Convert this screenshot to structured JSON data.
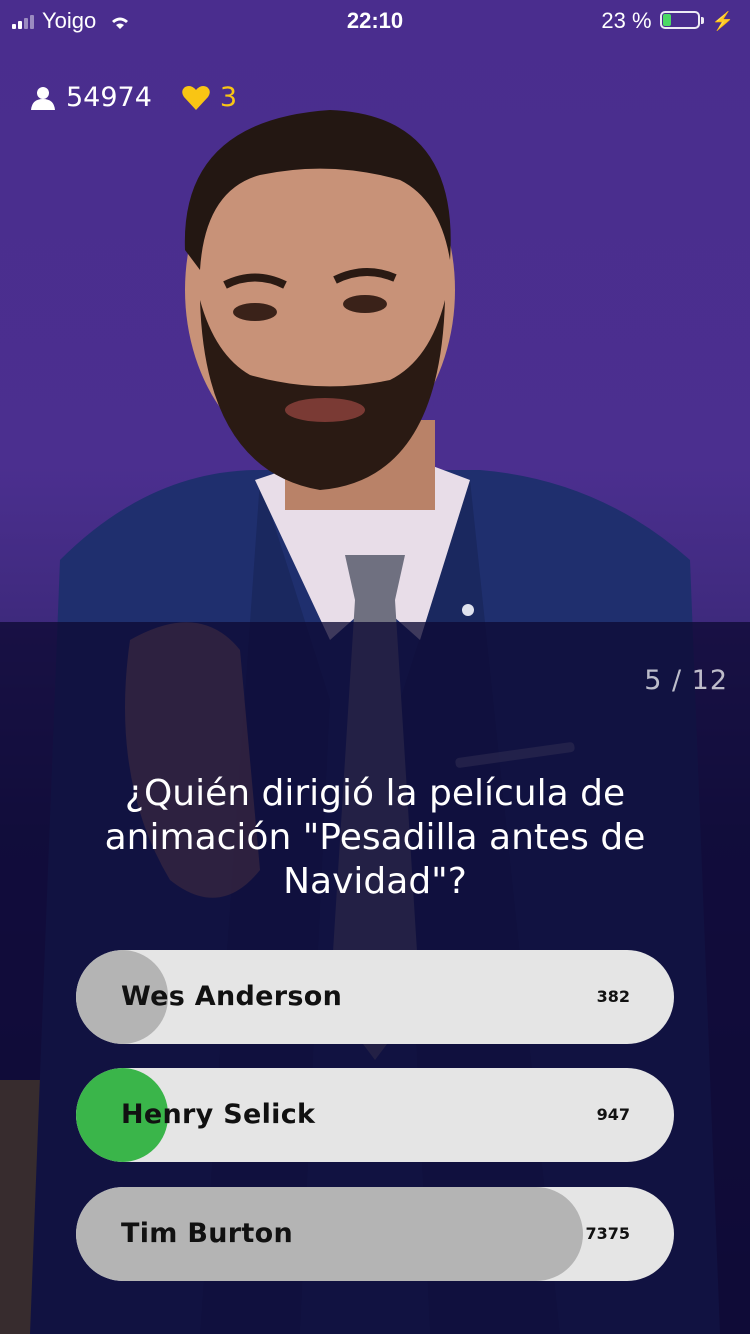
{
  "status_bar": {
    "carrier": "Yoigo",
    "time": "22:10",
    "battery_percent": "23 %",
    "battery_level": 0.23
  },
  "stats": {
    "viewers": "54974",
    "lives": "3",
    "lives_color": "#f9c514"
  },
  "quiz": {
    "counter": "5 / 12",
    "question": "¿Quién dirigió la película de animación \"Pesadilla antes de Navidad\"?",
    "answers": [
      {
        "label": "Wes Anderson",
        "count": "382",
        "share": 0.044,
        "state": "wrong",
        "fill_color": "#b4b4b4"
      },
      {
        "label": "Henry Selick",
        "count": "947",
        "share": 0.109,
        "state": "correct",
        "fill_color": "#3ab54a"
      },
      {
        "label": "Tim Burton",
        "count": "7375",
        "share": 0.847,
        "state": "wrong",
        "fill_color": "#b4b4b4"
      }
    ]
  },
  "colors": {
    "background": "#4a2d8e",
    "panel": "#0e0a34",
    "answer_bg": "#e5e5e5",
    "correct": "#3ab54a",
    "wrong": "#b4b4b4"
  }
}
